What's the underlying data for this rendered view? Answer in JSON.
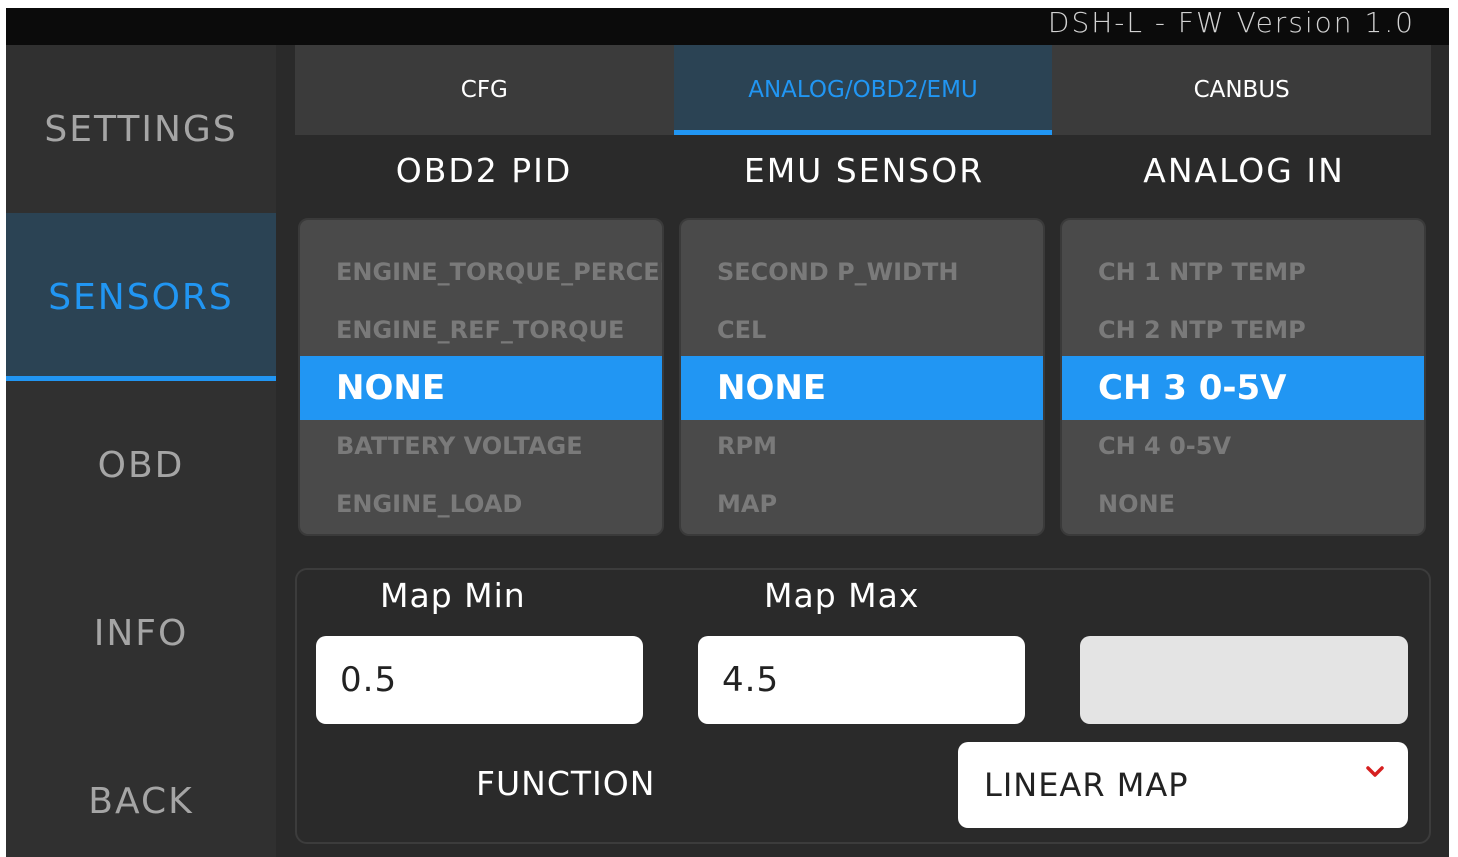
{
  "header": {
    "fw_version": "DSH-L - FW Version 1.0"
  },
  "sidebar": {
    "items": [
      {
        "label": "SETTINGS",
        "active": false
      },
      {
        "label": "SENSORS",
        "active": true
      },
      {
        "label": "OBD",
        "active": false
      },
      {
        "label": "INFO",
        "active": false
      },
      {
        "label": "BACK",
        "active": false
      }
    ]
  },
  "tabs": [
    {
      "label": "CFG",
      "active": false
    },
    {
      "label": "ANALOG/OBD2/EMU",
      "active": true
    },
    {
      "label": "CANBUS",
      "active": false
    }
  ],
  "columns": {
    "obd2": {
      "title": "OBD2 PID",
      "options": [
        "ENGINE_TORQUE_PERCENT",
        "ENGINE_REF_TORQUE",
        "NONE",
        "BATTERY VOLTAGE",
        "ENGINE_LOAD"
      ],
      "selected": "NONE"
    },
    "emu": {
      "title": "EMU SENSOR",
      "options": [
        "SECOND P_WIDTH",
        "CEL",
        "NONE",
        "RPM",
        "MAP"
      ],
      "selected": "NONE"
    },
    "analog": {
      "title": "ANALOG IN",
      "options": [
        "CH 1 NTP TEMP",
        "CH 2 NTP TEMP",
        "CH 3  0-5V",
        "CH 4  0-5V",
        "NONE"
      ],
      "selected": "CH 3  0-5V"
    }
  },
  "mapping": {
    "min_label": "Map Min",
    "min_value": "0.5",
    "max_label": "Map Max",
    "max_value": "4.5",
    "third_value": "",
    "function_label": "FUNCTION",
    "function_value": "LINEAR MAP"
  },
  "colors": {
    "accent": "#2196f3",
    "active_bg": "#2b4354",
    "background": "#2a2a2a"
  }
}
